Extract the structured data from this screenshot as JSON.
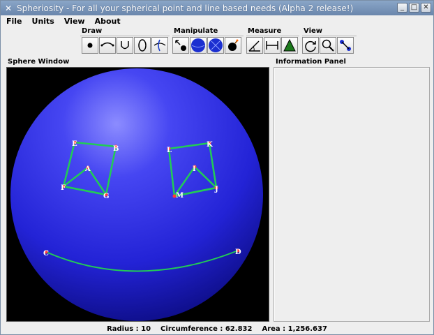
{
  "window": {
    "title": "Spheriosity - For all your spherical point and line based needs (Alpha 2 release!)",
    "title_icon": "app-x-icon",
    "buttons": {
      "minimize": "_",
      "maximize": "□",
      "close": "✕"
    }
  },
  "menubar": {
    "items": [
      "File",
      "Units",
      "View",
      "About"
    ]
  },
  "toolbar": {
    "groups": [
      {
        "label": "Draw",
        "tools": [
          "point-tool-icon",
          "arc-tool-icon",
          "curve-tool-icon",
          "circle-tool-icon",
          "intersect-tool-icon"
        ]
      },
      {
        "label": "Manipulate",
        "tools": [
          "move-point-icon",
          "rotate-sphere-icon",
          "rotate-axis-icon",
          "delete-bomb-icon"
        ]
      },
      {
        "label": "Measure",
        "tools": [
          "angle-measure-icon",
          "distance-measure-icon",
          "area-measure-icon"
        ]
      },
      {
        "label": "View",
        "tools": [
          "rotate-view-icon",
          "zoom-icon",
          "pan-view-icon"
        ]
      }
    ]
  },
  "panels": {
    "sphere_window": "Sphere Window",
    "info_panel": "Information Panel"
  },
  "points": [
    "E",
    "B",
    "A",
    "F",
    "G",
    "L",
    "K",
    "I",
    "M",
    "J",
    "C",
    "D"
  ],
  "status": {
    "radius": "Radius : 10",
    "circumference": "Circumference : 62.832",
    "area": "Area : 1,256.637"
  },
  "colors": {
    "sphere": "#2a2ad8",
    "lines": "#22cc55",
    "background": "#000000"
  }
}
